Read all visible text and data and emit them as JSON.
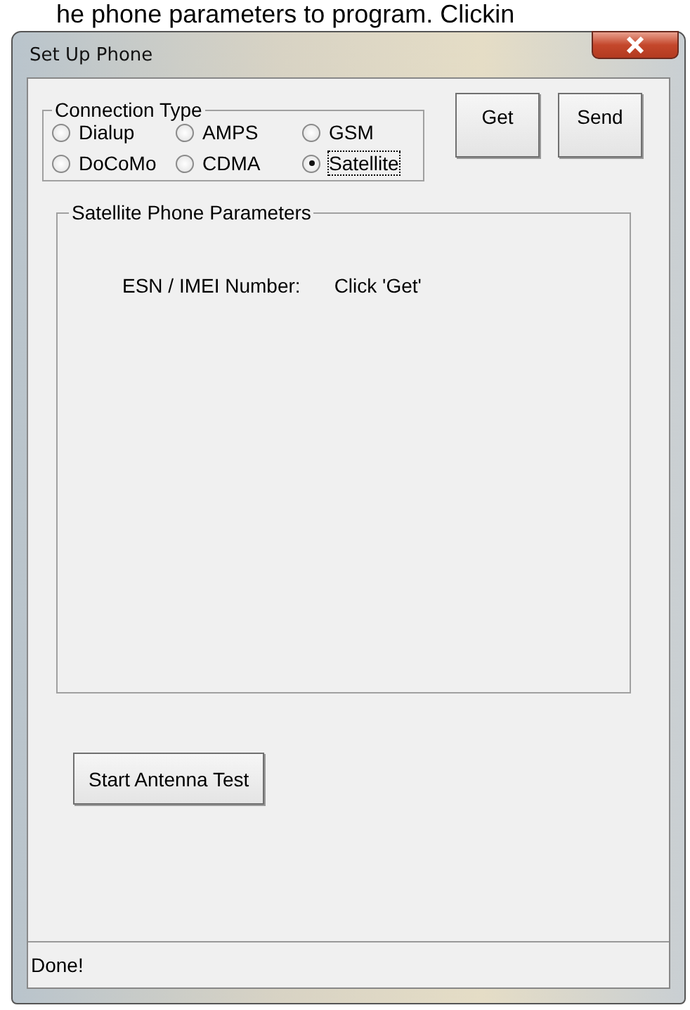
{
  "background_text": "he phone parameters to program.  Clickin",
  "window": {
    "title": "Set Up Phone"
  },
  "connection_type": {
    "label": "Connection Type",
    "options": [
      {
        "label": "Dialup",
        "selected": false
      },
      {
        "label": "AMPS",
        "selected": false
      },
      {
        "label": "GSM",
        "selected": false
      },
      {
        "label": "DoCoMo",
        "selected": false
      },
      {
        "label": "CDMA",
        "selected": false
      },
      {
        "label": "Satellite",
        "selected": true
      }
    ]
  },
  "buttons": [
    "Get",
    "Send"
  ],
  "parameters": {
    "label": "Satellite Phone Parameters",
    "field_label": "ESN / IMEI Number:",
    "field_value": "Click 'Get'"
  },
  "antenna_button": "Start Antenna Test",
  "status_bar": "Done!"
}
